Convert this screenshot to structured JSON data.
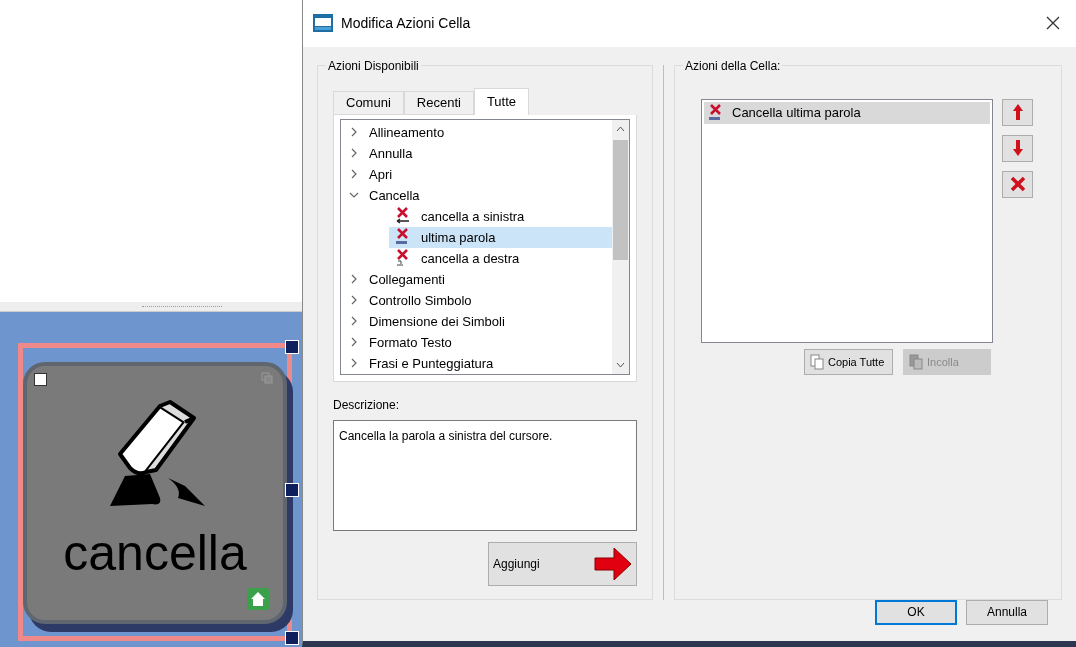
{
  "window": {
    "title": "Modifica Azioni Cella"
  },
  "available": {
    "title": "Azioni Disponibili",
    "tabs": [
      {
        "label": "Comuni",
        "selected": false
      },
      {
        "label": "Recenti",
        "selected": false
      },
      {
        "label": "Tutte",
        "selected": true
      }
    ],
    "tree": [
      {
        "label": "Allineamento",
        "expanded": false
      },
      {
        "label": "Annulla",
        "expanded": false
      },
      {
        "label": "Apri",
        "expanded": false
      },
      {
        "label": "Cancella",
        "expanded": true,
        "children": [
          {
            "label": "cancella a sinistra",
            "selected": false,
            "kind": "left"
          },
          {
            "label": "ultima parola",
            "selected": true,
            "kind": "word"
          },
          {
            "label": "cancella a destra",
            "selected": false,
            "kind": "right"
          }
        ]
      },
      {
        "label": "Collegamenti",
        "expanded": false
      },
      {
        "label": "Controllo Simbolo",
        "expanded": false
      },
      {
        "label": "Dimensione dei Simboli",
        "expanded": false
      },
      {
        "label": "Formato Testo",
        "expanded": false
      },
      {
        "label": "Frasi e Punteggiatura",
        "expanded": false
      }
    ],
    "description_label": "Descrizione:",
    "description": "Cancella la parola a sinistra del cursore.",
    "add_button": "Aggiungi"
  },
  "cell_actions": {
    "title": "Azioni della Cella:",
    "items": [
      {
        "label": "Cancella ultima parola",
        "selected": true
      }
    ],
    "copy_button": {
      "label": "Copia Tutte",
      "disabled": false
    },
    "paste_button": {
      "label": "Incolla",
      "disabled": true
    }
  },
  "buttons": [
    {
      "label": "OK",
      "default": true
    },
    {
      "label": "Annulla",
      "default": false
    }
  ],
  "cell": {
    "label": "cancella",
    "selected": true
  }
}
